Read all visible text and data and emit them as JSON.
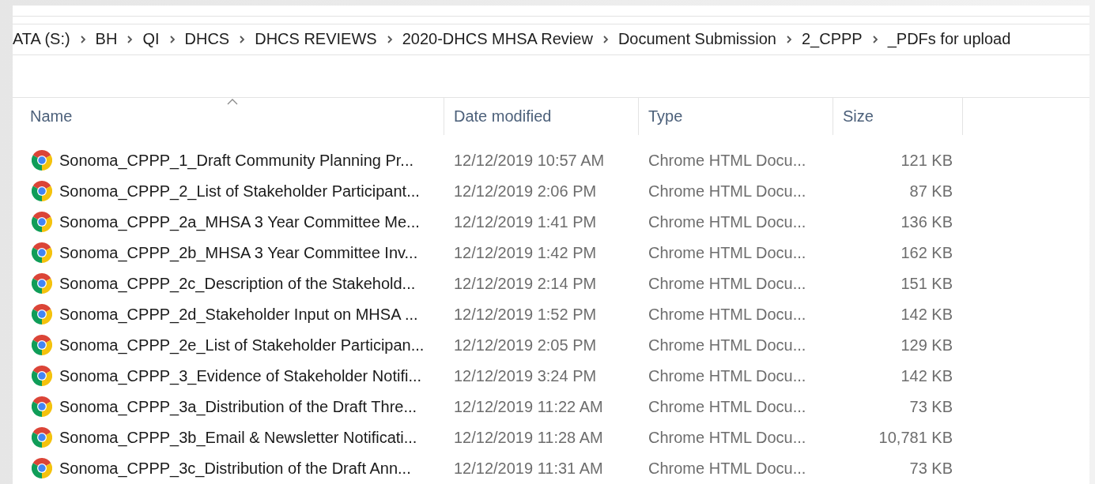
{
  "breadcrumb": [
    "ATA (S:)",
    "BH",
    "QI",
    "DHCS",
    "DHCS REVIEWS",
    "2020-DHCS MHSA Review",
    "Document Submission",
    "2_CPPP",
    "_PDFs for upload"
  ],
  "columns": [
    {
      "label": "Name",
      "sorted": true
    },
    {
      "label": "Date modified",
      "sorted": false
    },
    {
      "label": "Type",
      "sorted": false
    },
    {
      "label": "Size",
      "sorted": false
    }
  ],
  "rows": [
    {
      "name": "Sonoma_CPPP_1_Draft Community Planning Pr...",
      "date": "12/12/2019 10:57 AM",
      "type": "Chrome HTML Docu...",
      "size": "121 KB"
    },
    {
      "name": "Sonoma_CPPP_2_List of Stakeholder Participant...",
      "date": "12/12/2019 2:06 PM",
      "type": "Chrome HTML Docu...",
      "size": "87 KB"
    },
    {
      "name": "Sonoma_CPPP_2a_MHSA 3 Year Committee Me...",
      "date": "12/12/2019 1:41 PM",
      "type": "Chrome HTML Docu...",
      "size": "136 KB"
    },
    {
      "name": "Sonoma_CPPP_2b_MHSA 3 Year Committee Inv...",
      "date": "12/12/2019 1:42 PM",
      "type": "Chrome HTML Docu...",
      "size": "162 KB"
    },
    {
      "name": "Sonoma_CPPP_2c_Description of the Stakehold...",
      "date": "12/12/2019 2:14 PM",
      "type": "Chrome HTML Docu...",
      "size": "151 KB"
    },
    {
      "name": "Sonoma_CPPP_2d_Stakeholder Input on MHSA ...",
      "date": "12/12/2019 1:52 PM",
      "type": "Chrome HTML Docu...",
      "size": "142 KB"
    },
    {
      "name": "Sonoma_CPPP_2e_List of Stakeholder Participan...",
      "date": "12/12/2019 2:05 PM",
      "type": "Chrome HTML Docu...",
      "size": "129 KB"
    },
    {
      "name": "Sonoma_CPPP_3_Evidence of Stakeholder Notifi...",
      "date": "12/12/2019 3:24 PM",
      "type": "Chrome HTML Docu...",
      "size": "142 KB"
    },
    {
      "name": "Sonoma_CPPP_3a_Distribution of the Draft Thre...",
      "date": "12/12/2019 11:22 AM",
      "type": "Chrome HTML Docu...",
      "size": "73 KB"
    },
    {
      "name": "Sonoma_CPPP_3b_Email & Newsletter Notificati...",
      "date": "12/12/2019 11:28 AM",
      "type": "Chrome HTML Docu...",
      "size": "10,781 KB"
    },
    {
      "name": "Sonoma_CPPP_3c_Distribution of the Draft Ann...",
      "date": "12/12/2019 11:31 AM",
      "type": "Chrome HTML Docu...",
      "size": "73 KB"
    }
  ]
}
